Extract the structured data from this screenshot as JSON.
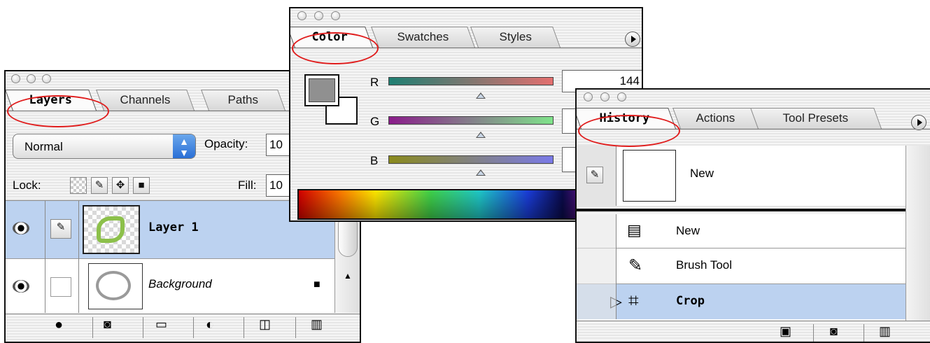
{
  "layers_panel": {
    "tabs": [
      "Layers",
      "Channels",
      "Paths"
    ],
    "blend_mode": "Normal",
    "opacity_label": "Opacity:",
    "opacity_value": "10",
    "lock_label": "Lock:",
    "fill_label": "Fill:",
    "fill_value": "10",
    "layers": [
      {
        "name": "Layer 1",
        "selected": true,
        "visible": true
      },
      {
        "name": "Background",
        "selected": false,
        "visible": true,
        "locked": true
      }
    ]
  },
  "color_panel": {
    "tabs": [
      "Color",
      "Swatches",
      "Styles"
    ],
    "channels": [
      {
        "label": "R",
        "value": "144",
        "level": 0.56
      },
      {
        "label": "G",
        "value": "",
        "level": 0.56
      },
      {
        "label": "B",
        "value": "",
        "level": 0.56
      }
    ],
    "foreground_color": "#909090",
    "background_color": "#ffffff"
  },
  "history_panel": {
    "tabs": [
      "History",
      "Actions",
      "Tool Presets"
    ],
    "snapshot_name": "New",
    "states": [
      {
        "name": "New",
        "selected": false
      },
      {
        "name": "Brush Tool",
        "selected": false
      },
      {
        "name": "Crop",
        "selected": true
      }
    ]
  },
  "colors": {
    "highlight": "#e01b1b",
    "selection": "#bcd2f0"
  }
}
